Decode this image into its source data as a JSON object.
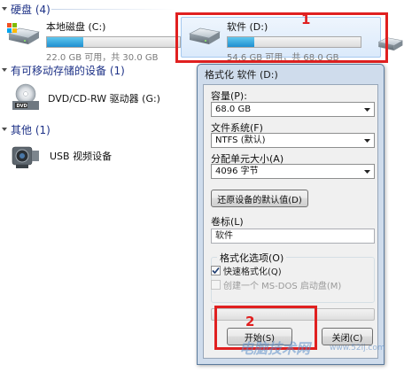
{
  "groups": {
    "hard_disks": "硬盘 (4)",
    "removable": "有可移动存储的设备 (1)",
    "other": "其他 (1)"
  },
  "drives": {
    "c": {
      "name": "本地磁盘 (C:)",
      "space": "22.0 GB 可用，共 30.0 GB",
      "used_fraction": 0.27
    },
    "d": {
      "name": "软件 (D:)",
      "space": "54.6 GB 可用，共 68.0 GB",
      "used_fraction": 0.2
    }
  },
  "devices": {
    "dvd": "DVD/CD-RW 驱动器 (G:)",
    "usb_video": "USB 视频设备"
  },
  "annotations": {
    "one": "1",
    "two": "2"
  },
  "format_dialog": {
    "title": "格式化 软件 (D:)",
    "capacity_label": "容量(P):",
    "capacity_value": "68.0 GB",
    "filesystem_label": "文件系统(F)",
    "filesystem_value": "NTFS (默认)",
    "allocation_label": "分配单元大小(A)",
    "allocation_value": "4096 字节",
    "restore_defaults": "还原设备的默认值(D)",
    "volume_label": "卷标(L)",
    "volume_value": "软件",
    "options_legend": "格式化选项(O)",
    "quick_format": "快速格式化(Q)",
    "quick_format_checked": true,
    "msdos_disk": "创建一个 MS-DOS 启动盘(M)",
    "progress": 0,
    "start_button": "开始(S)",
    "close_button": "关闭(C)"
  },
  "watermark": {
    "text": "电脑技术网",
    "url": "www.52ij.com"
  }
}
